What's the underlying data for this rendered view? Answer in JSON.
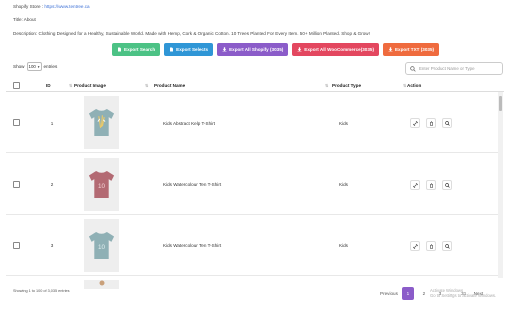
{
  "store": {
    "label": "Shopify Store :",
    "url": "https://www.tentree.ca",
    "title": "Title: About",
    "description": "Description: Clothing Designed for a Healthy, Sustainable World. Made with Hemp, Cork & Organic Cotton. 10 Trees Planted For Every Item. 50+ Million Planted. Shop & Grow!"
  },
  "buttons": [
    {
      "label": "Export Search",
      "color": "#4cc285",
      "icon": "file-icon"
    },
    {
      "label": "Export Selects",
      "color": "#2f96d6",
      "icon": "file-icon"
    },
    {
      "label": "Export All Shopify (3035)",
      "color": "#8b5cc9",
      "icon": "download-icon"
    },
    {
      "label": "Export All WooCommerce(3035)",
      "color": "#e3475f",
      "icon": "download-icon"
    },
    {
      "label": "Export TXT (3035)",
      "color": "#ef6b3e",
      "icon": "download-icon"
    }
  ],
  "controls": {
    "show": "Show",
    "page_size": "100",
    "entries": "entries",
    "search_placeholder": "Enter Product Name or Type"
  },
  "table": {
    "headers": {
      "id": "ID",
      "image": "Product Image",
      "name": "Product Name",
      "type": "Product Type",
      "action": "Action"
    },
    "rows": [
      {
        "id": "1",
        "name": "Kids Abstract Kelp T-Shirt",
        "type": "Kids",
        "shirt_color": "#8fb0b5"
      },
      {
        "id": "2",
        "name": "Kids Watercolour Ten T-Shirt",
        "type": "Kids",
        "shirt_color": "#b36a73"
      },
      {
        "id": "3",
        "name": "Kids Watercolour Ten T-Shirt",
        "type": "Kids",
        "shirt_color": "#8fb0b5"
      }
    ]
  },
  "footer": {
    "info": "Showing 1 to 100 of 3,035 entries"
  },
  "pagination": {
    "previous": "Previous",
    "pages": [
      "1",
      "2",
      "3",
      "31"
    ],
    "ellipsis": "...",
    "next": "Next"
  },
  "watermark": {
    "line1": "Activate Windows",
    "line2": "Go to Settings to activate Windows."
  }
}
